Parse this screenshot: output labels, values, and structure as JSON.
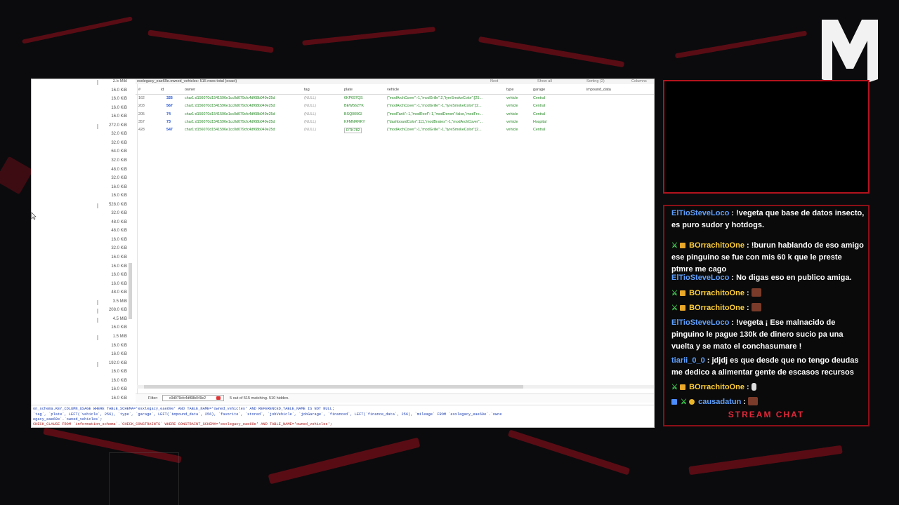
{
  "app": {
    "title": "esxlegacy_eae69e.owned_vehicles: 515 rows total (exact)",
    "toolbar": {
      "next": "Next",
      "show_all": "Show all",
      "sorting": "Sorting (2)",
      "columns": "Columns"
    },
    "columns": [
      "#",
      "id",
      "owner",
      "tag",
      "plate",
      "vehicle",
      "type",
      "garage",
      "impound_data"
    ],
    "rows": [
      {
        "num": "162",
        "id": "326",
        "owner": "char1:d156070d1541596e1cc0d079cfc4df68b049e25d",
        "tag": "(NULL)",
        "plate": "6KP697QS",
        "vehicle": "{\"modArchCover\":-1,\"modGrille\":2,\"tyreSmokeColor\":[25...",
        "type": "vehicle",
        "garage": "Central"
      },
      {
        "num": "203",
        "id": "567",
        "owner": "char1:d156070d1541596e1cc0d079cfc4df68b049e25d",
        "tag": "(NULL)",
        "plate": "BEW562YK",
        "vehicle": "{\"modArchCover\":-1,\"modGrille\":-1,\"tyreSmokeColor\":[2...",
        "type": "vehicle",
        "garage": "Central"
      },
      {
        "num": "205",
        "id": "74",
        "owner": "char1:d156070d1541596e1cc0d079cfc4df68b049e25d",
        "tag": "(NULL)",
        "plate": "BSQ009GI",
        "vehicle": "{\"modTank\":-1,\"modRoof\":-1,\"modDenon\":false,\"modFro...",
        "type": "vehicle",
        "garage": "Central"
      },
      {
        "num": "357",
        "id": "73",
        "owner": "char1:d156070d1541596e1cc0d079cfc4df68b049e25d",
        "tag": "(NULL)",
        "plate": "KFMNRRKY",
        "vehicle": "{\"dashboardColor\":111,\"modBrakes\":-1,\"modArchCover\"...",
        "type": "vehicle",
        "garage": "Hospital"
      },
      {
        "num": "428",
        "id": "547",
        "owner": "char1:d156070d1541596e1cc0d079cfc4df68b049e25d",
        "tag": "(NULL)",
        "plate": "RTK782",
        "vehicle": "{\"modArchCover\":-1,\"modGrille\":-1,\"tyreSmokeColor\":[2...",
        "type": "vehicle",
        "garage": "Central"
      }
    ],
    "sizes": [
      "2.5 MiB",
      "16.0 KiB",
      "16.0 KiB",
      "16.0 KiB",
      "16.0 KiB",
      "272.0 KiB",
      "32.0 KiB",
      "32.0 KiB",
      "64.0 KiB",
      "32.0 KiB",
      "48.0 KiB",
      "32.0 KiB",
      "16.0 KiB",
      "16.0 KiB",
      "528.0 KiB",
      "32.0 KiB",
      "48.0 KiB",
      "48.0 KiB",
      "16.0 KiB",
      "32.0 KiB",
      "16.0 KiB",
      "16.0 KiB",
      "16.0 KiB",
      "16.0 KiB",
      "48.0 KiB",
      "3.5 MiB",
      "208.0 KiB",
      "4.5 MiB",
      "16.0 KiB",
      "1.5 MiB",
      "16.0 KiB",
      "16.0 KiB",
      "192.0 KiB",
      "16.0 KiB",
      "16.0 KiB",
      "16.0 KiB",
      "16.0 KiB"
    ],
    "filter": {
      "label": "Filter:",
      "value": "c0d079cfc4df68b049e2",
      "status": "5 out of 515 matching. 510 hidden."
    },
    "sql_lines": [
      "on_schema.KEY_COLUMN_USAGE  WHERE   TABLE_SCHEMA='esxlegacy_eae69e'   AND TABLE_NAME='owned_vehicles'   AND REFERENCED_TABLE_NAME IS NOT NULL;",
      "  `tag`, `plate`, LEFT(`vehicle`, 256), `type`, `garage`, LEFT(`impound_data`, 256), `favorite`, `stored`, `jobVehicle`, `jobGarage`, `financed`, LEFT(`finance_data`, 256), `mileage`  FROM `esxlegacy_eae69e`.`owne",
      "egacy_eae69e`.`owned_vehicles`;",
      "  CHECK_CLAUSE FROM `information_schema`.`CHECK_CONSTRAINTS` WHERE CONSTRAINT_SCHEMA='esxlegacy_eae69e' AND TABLE_NAME='owned_vehicles';"
    ]
  },
  "chat": {
    "title": "STREAM CHAT",
    "messages": [
      {
        "user": "ElTioSteveLoco",
        "color": "#5ea0ff",
        "badges": [],
        "text": ": !vegeta que base de datos insecto, es puro sudor y hotdogs."
      },
      {
        "user": "BOrrachitoOne",
        "color": "#ffcf3a",
        "badges": [
          "sword-icon",
          "gift-icon"
        ],
        "text": ": !burun hablando de eso amigo ese pinguino se fue con mis 60 k que le preste ptmre me cago"
      },
      {
        "user": "ElTioSteveLoco",
        "color": "#5ea0ff",
        "badges": [],
        "text": ": No digas eso en publico amiga."
      },
      {
        "user": "BOrrachitoOne",
        "color": "#ffcf3a",
        "badges": [
          "sword-icon",
          "gift-icon"
        ],
        "text": ":",
        "emote": true
      },
      {
        "user": "BOrrachitoOne",
        "color": "#ffcf3a",
        "badges": [
          "sword-icon",
          "gift-icon"
        ],
        "text": ":",
        "emote": true
      },
      {
        "user": "ElTioSteveLoco",
        "color": "#5ea0ff",
        "badges": [],
        "text": ": !vegeta ¡ Ese malnacido de pinguino le pague 130k de dinero sucio pa una vuelta y se mato el conchasumare !"
      },
      {
        "user": "tiarii_0_0",
        "color": "#5ea0ff",
        "badges": [],
        "text": ": jdjdj es que desde que no tengo deudas me dedico a alimentar gente de escasos recursos"
      },
      {
        "user": "BOrrachitoOne",
        "color": "#ffcf3a",
        "badges": [
          "sword-icon",
          "gift-icon"
        ],
        "text": ":",
        "emote2": true
      },
      {
        "user": "causadatun",
        "color": "#5ea0ff",
        "badges": [
          "prime-icon",
          "sword-icon",
          "vip-icon"
        ],
        "text": ":",
        "emote": true
      }
    ]
  }
}
